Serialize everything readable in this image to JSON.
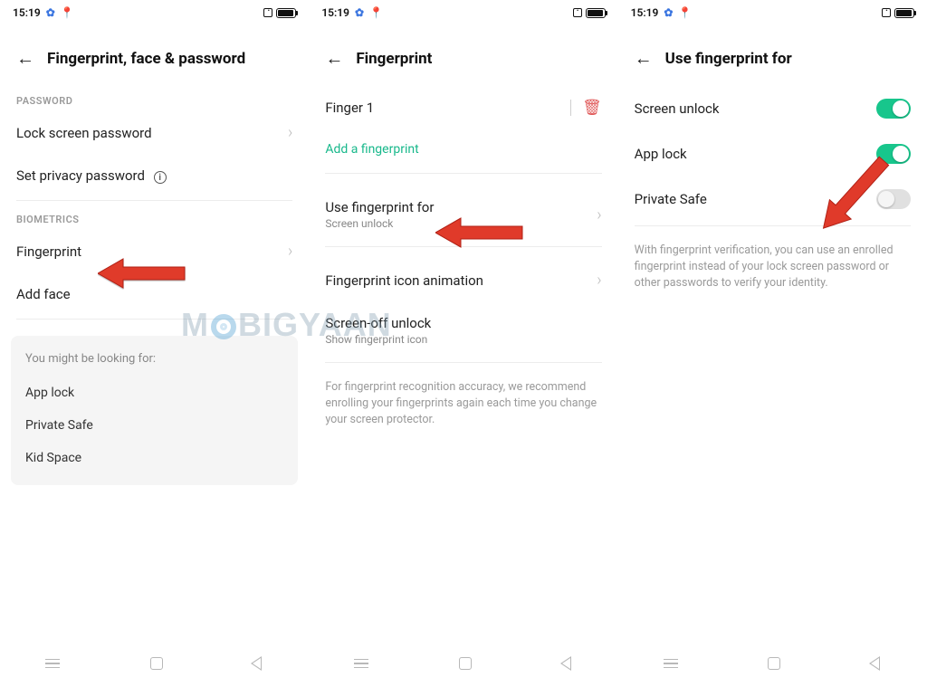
{
  "status": {
    "time": "15:19"
  },
  "screen1": {
    "title": "Fingerprint, face & password",
    "section_password": "PASSWORD",
    "lock_screen_password": "Lock screen password",
    "set_privacy_password": "Set privacy password",
    "section_biometrics": "BIOMETRICS",
    "fingerprint": "Fingerprint",
    "add_face": "Add face",
    "suggest_title": "You might be looking for:",
    "suggest_items": [
      "App lock",
      "Private Safe",
      "Kid Space"
    ]
  },
  "screen2": {
    "title": "Fingerprint",
    "finger1": "Finger 1",
    "add_fingerprint": "Add a fingerprint",
    "use_for_title": "Use fingerprint for",
    "use_for_sub": "Screen unlock",
    "icon_anim": "Fingerprint icon animation",
    "screen_off_unlock": "Screen-off unlock",
    "show_icon": "Show fingerprint icon",
    "desc": "For fingerprint recognition accuracy, we recommend enrolling your fingerprints again each time you change your screen protector."
  },
  "screen3": {
    "title": "Use fingerprint for",
    "screen_unlock": "Screen unlock",
    "app_lock": "App lock",
    "private_safe": "Private Safe",
    "desc": "With fingerprint verification, you can use an enrolled fingerprint instead of your lock screen password or other passwords to verify your identity."
  },
  "watermark": "MOBIGYAAN"
}
